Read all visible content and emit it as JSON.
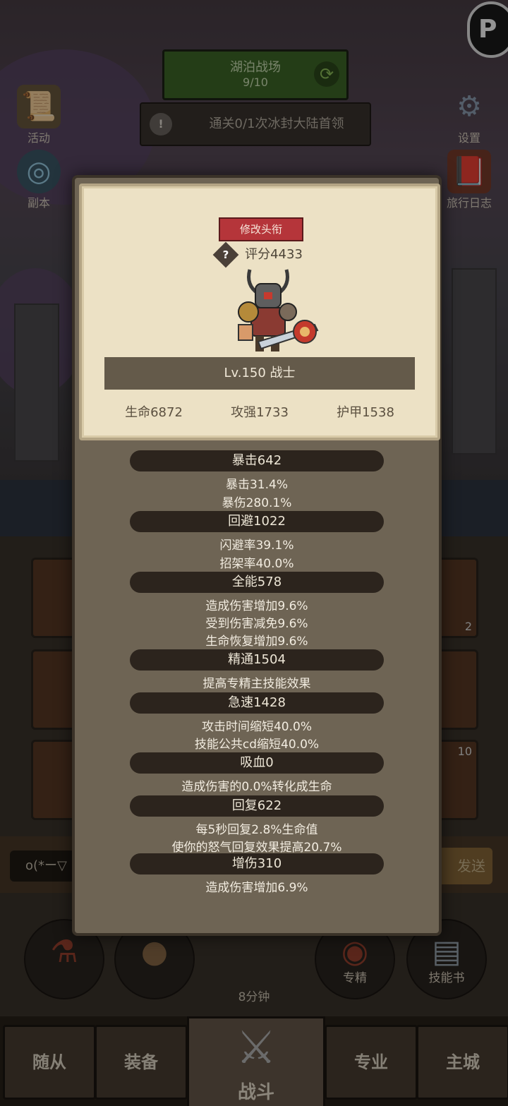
{
  "stage": {
    "name": "湖泊战场",
    "progress": "9/10",
    "refresh_icon": "refresh-icon"
  },
  "quest": {
    "icon": "alert-icon",
    "icon_text": "!",
    "text": "通关0/1次冰封大陆首领"
  },
  "side_left": [
    {
      "label": "活动",
      "icon": "scroll-icon"
    },
    {
      "label": "副本",
      "icon": "portal-icon"
    }
  ],
  "side_right": [
    {
      "label": "设置",
      "icon": "gear-icon"
    },
    {
      "label": "旅行日志",
      "icon": "book-icon"
    }
  ],
  "corner_badge": "P",
  "card": {
    "change_title_button": "修改头衔",
    "help_icon_text": "?",
    "score": "评分4433",
    "level_class": "Lv.150 战士",
    "hp": "生命6872",
    "attack": "攻强1733",
    "armor": "护甲1538"
  },
  "stats": [
    {
      "header": "暴击642",
      "lines": [
        "暴击31.4%",
        "暴伤280.1%"
      ]
    },
    {
      "header": "回避1022",
      "lines": [
        "闪避率39.1%",
        "招架率40.0%"
      ]
    },
    {
      "header": "全能578",
      "lines": [
        "造成伤害增加9.6%",
        "受到伤害减免9.6%",
        "生命恢复增加9.6%"
      ]
    },
    {
      "header": "精通1504",
      "lines": [
        "提高专精主技能效果"
      ]
    },
    {
      "header": "急速1428",
      "lines": [
        "攻击时间缩短40.0%",
        "技能公共cd缩短40.0%"
      ]
    },
    {
      "header": "吸血0",
      "lines": [
        "造成伤害的0.0%转化成生命"
      ]
    },
    {
      "header": "回复622",
      "lines": [
        "每5秒回复2.8%生命值",
        "使你的怒气回复效果提高20.7%"
      ]
    },
    {
      "header": "增伤310",
      "lines": [
        "造成伤害增加6.9%"
      ]
    }
  ],
  "background_slots": {
    "slot_count_a": "2",
    "slot_count_b": "10"
  },
  "chat": {
    "input_text": "o(*ー▽",
    "send_label": "发送"
  },
  "actions": [
    {
      "label": "",
      "icon": "potion-icon"
    },
    {
      "label": "",
      "icon": "bread-icon"
    },
    {
      "label": "专精",
      "icon": "specialization-icon"
    },
    {
      "label": "技能书",
      "icon": "skill-book-icon"
    }
  ],
  "chest_timer": "8分钟",
  "nav": {
    "followers": "随从",
    "equipment": "装备",
    "battle": "战斗",
    "profession": "专业",
    "main_city": "主城"
  }
}
